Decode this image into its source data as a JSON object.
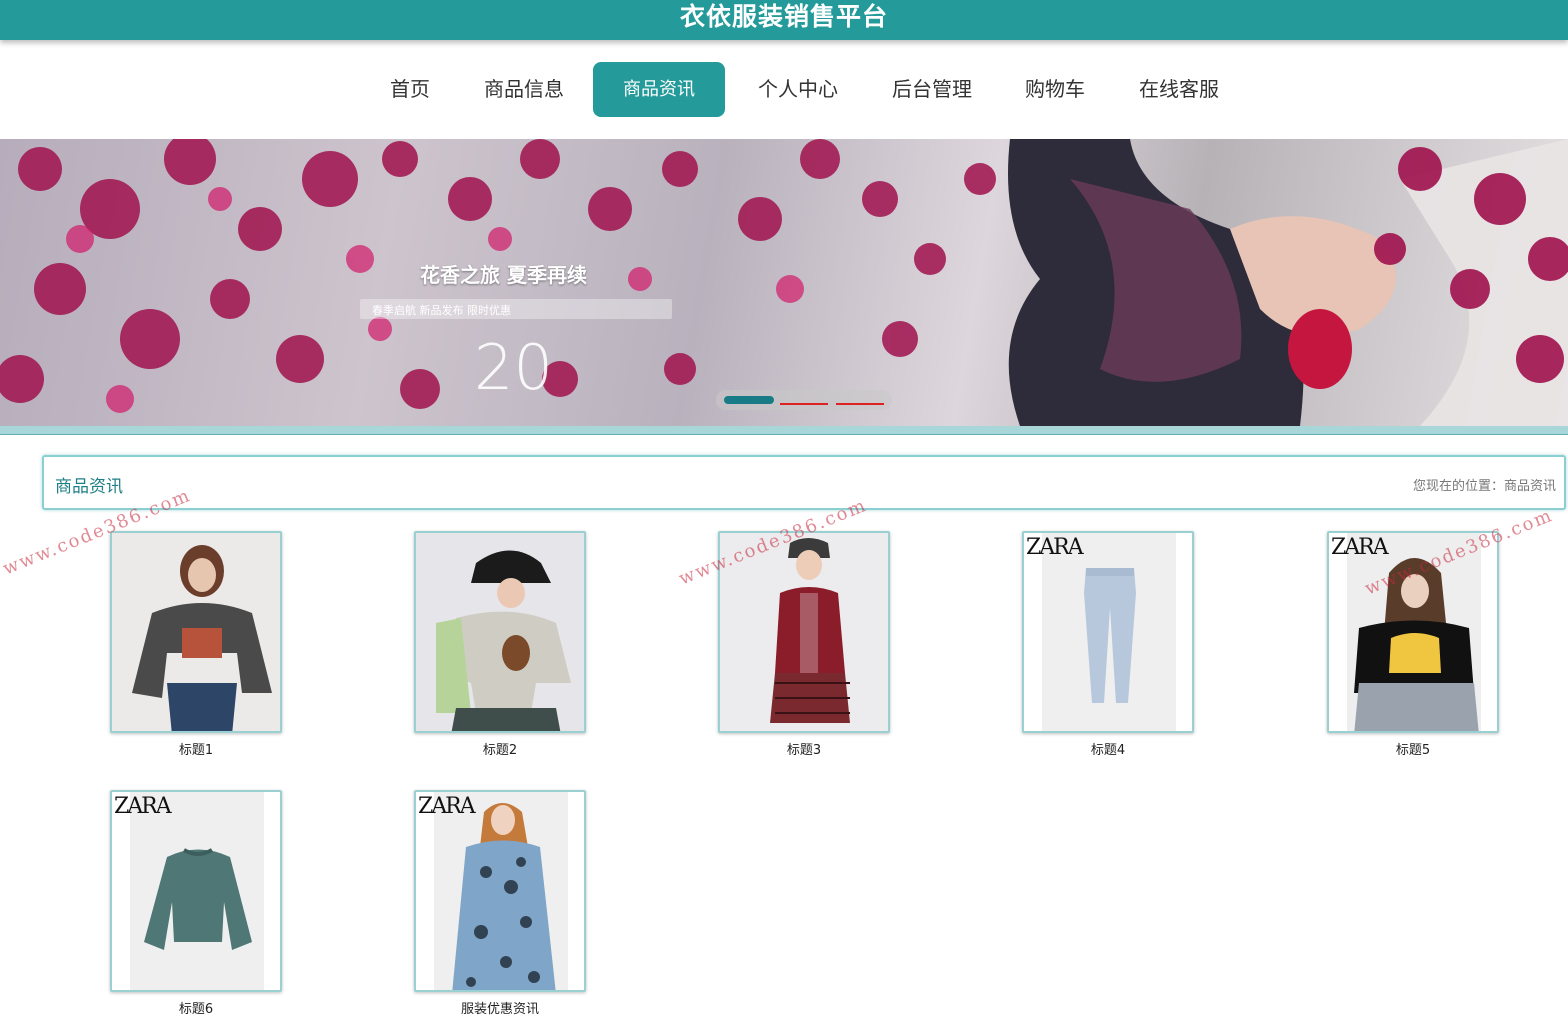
{
  "header": {
    "title": "衣依服装销售平台"
  },
  "nav": {
    "items": [
      {
        "label": "首页"
      },
      {
        "label": "商品信息"
      },
      {
        "label": "商品资讯"
      },
      {
        "label": "个人中心"
      },
      {
        "label": "后台管理"
      },
      {
        "label": "购物车"
      },
      {
        "label": "在线客服"
      }
    ],
    "active_index": 2
  },
  "banner": {
    "headline": "花香之旅 夏季再续",
    "subline": "春季启航 新品发布 限时优惠",
    "year": "20",
    "slides": 3,
    "active_slide": 1
  },
  "section": {
    "title": "商品资讯",
    "breadcrumb": "您现在的位置：商品资讯"
  },
  "items": [
    {
      "caption": "标题1",
      "image": "gray-sweatshirt-photo"
    },
    {
      "caption": "标题2",
      "image": "bucket-hat-sweater-photo"
    },
    {
      "caption": "标题3",
      "image": "red-cardigan-photo"
    },
    {
      "caption": "标题4",
      "image": "jeans-photo",
      "brand": "ZARA"
    },
    {
      "caption": "标题5",
      "image": "black-tshirt-photo",
      "brand": "ZARA"
    },
    {
      "caption": "标题6",
      "image": "green-sweatshirt-photo",
      "brand": "ZARA"
    },
    {
      "caption": "服装优惠资讯",
      "image": "floral-dress-photo",
      "brand": "ZARA"
    }
  ],
  "watermark": "www.code386.com",
  "colors": {
    "primary": "#249a9a",
    "border": "#9bd0d3",
    "watermark": "#c8283c"
  }
}
